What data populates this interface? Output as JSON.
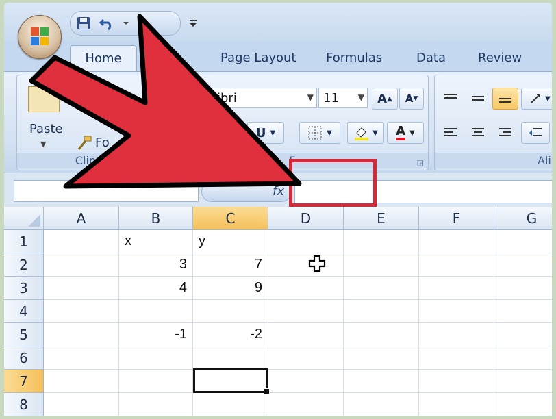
{
  "tabs": [
    {
      "label": "Home",
      "active": true
    },
    {
      "label": "Page Layout"
    },
    {
      "label": "Formulas"
    },
    {
      "label": "Data"
    },
    {
      "label": "Review"
    }
  ],
  "ribbon": {
    "clipboard": {
      "paste_label": "Paste",
      "format_label": "Fo",
      "group_label": "Clip"
    },
    "font": {
      "font_name": "libri",
      "font_size": "11",
      "grow_label": "A",
      "shrink_label": "A",
      "underline_label": "U",
      "font_color_label": "A",
      "group_label": "F"
    },
    "alignment": {
      "group_label": "Ali"
    }
  },
  "formula_bar": {
    "fx_label": "fx",
    "name_box": "",
    "formula": ""
  },
  "columns": [
    "A",
    "B",
    "C",
    "D",
    "E",
    "F",
    "G"
  ],
  "selected_column": "C",
  "selected_row": "7",
  "rows": [
    {
      "num": "1",
      "cells": [
        "",
        "x",
        "y",
        "",
        "",
        "",
        ""
      ]
    },
    {
      "num": "2",
      "cells": [
        "",
        "3",
        "7",
        "",
        "",
        "",
        ""
      ]
    },
    {
      "num": "3",
      "cells": [
        "",
        "4",
        "9",
        "",
        "",
        "",
        ""
      ]
    },
    {
      "num": "4",
      "cells": [
        "",
        "",
        "",
        "",
        "",
        "",
        ""
      ]
    },
    {
      "num": "5",
      "cells": [
        "",
        "-1",
        "-2",
        "",
        "",
        "",
        ""
      ]
    },
    {
      "num": "6",
      "cells": [
        "",
        "",
        "",
        "",
        "",
        "",
        ""
      ]
    },
    {
      "num": "7",
      "cells": [
        "",
        "",
        "",
        "",
        "",
        "",
        ""
      ]
    },
    {
      "num": "8",
      "cells": [
        "",
        "",
        "",
        "",
        "",
        "",
        ""
      ]
    }
  ],
  "colors": {
    "arrow_fill": "#e0303e",
    "highlight_box": "#d42a3a",
    "selected_header": "#f5c05a"
  }
}
